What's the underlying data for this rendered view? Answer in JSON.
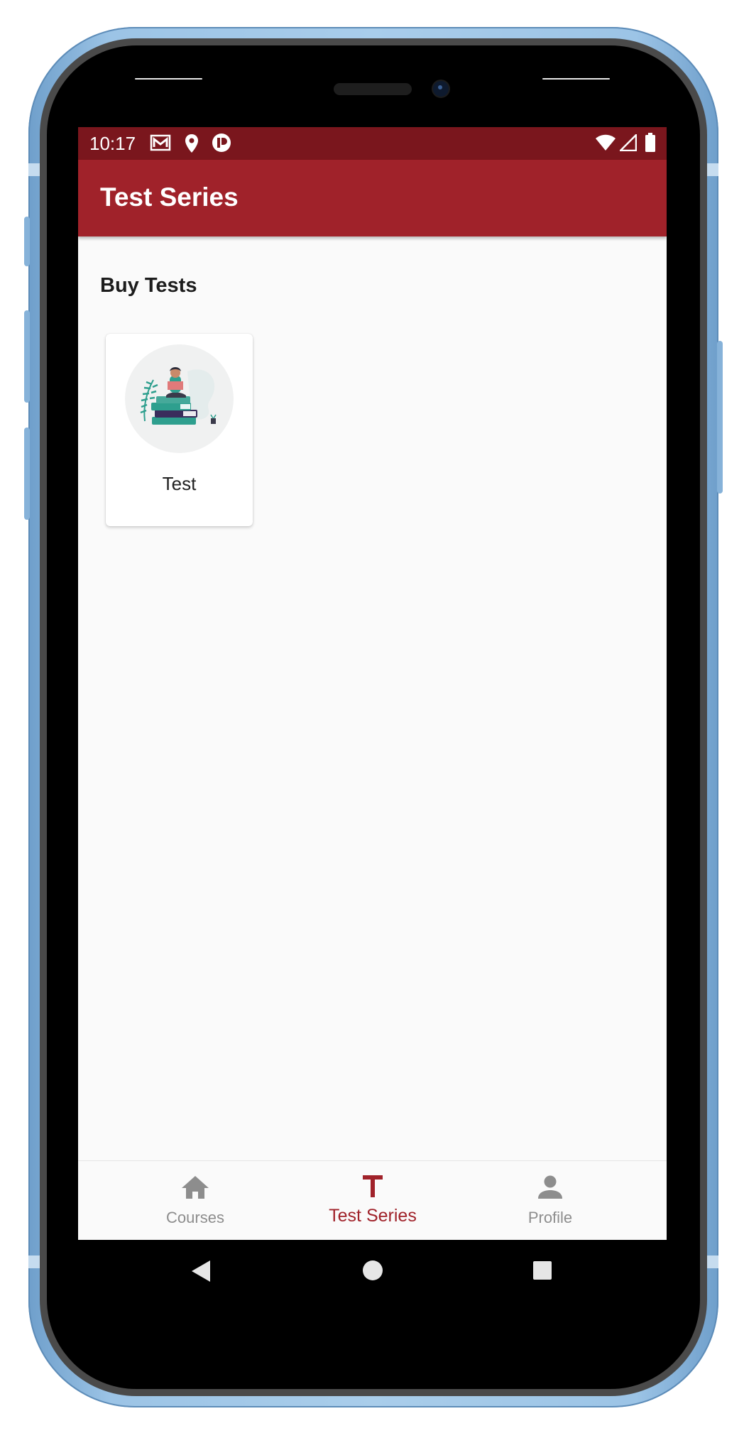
{
  "status_bar": {
    "time": "10:17",
    "left_icons": [
      "gmail-icon",
      "location-icon",
      "app-notification-icon"
    ],
    "right_icons": [
      "wifi-icon",
      "signal-icon",
      "battery-icon"
    ],
    "background": "#7a161d"
  },
  "app_bar": {
    "title": "Test Series",
    "background": "#a0222a"
  },
  "main": {
    "section_title": "Buy Tests",
    "cards": [
      {
        "label": "Test",
        "image": "reading-person-illustration"
      }
    ]
  },
  "bottom_nav": {
    "items": [
      {
        "label": "Courses",
        "icon": "home-icon",
        "active": false
      },
      {
        "label": "Test Series",
        "icon": "letter-t-icon",
        "active": true
      },
      {
        "label": "Profile",
        "icon": "person-icon",
        "active": false
      }
    ],
    "active_color": "#a0222a",
    "inactive_color": "#8d8d8d"
  },
  "system_nav": {
    "buttons": [
      "back-button",
      "home-button",
      "recents-button"
    ]
  }
}
